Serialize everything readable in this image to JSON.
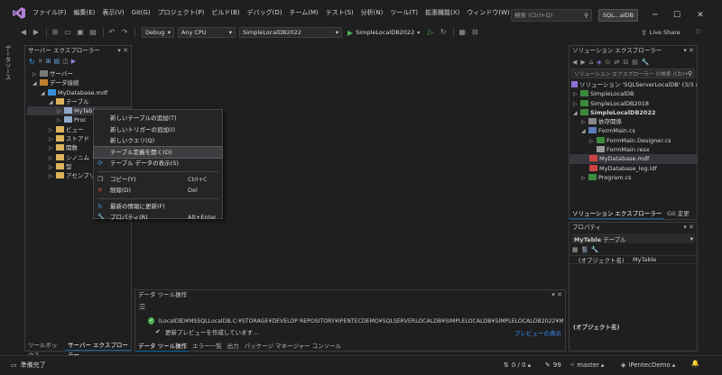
{
  "titlebar": {
    "menus": [
      "ファイル(F)",
      "編集(E)",
      "表示(V)",
      "Git(G)",
      "プロジェクト(P)",
      "ビルド(B)",
      "デバッグ(D)",
      "テスト(S)",
      "分析(N)",
      "ツール(T)",
      "拡張機能(X)",
      "ウィンドウ(W)",
      "ヘルプ(H)"
    ],
    "menu_extra": "チーム(M)",
    "search_placeholder": "検索 (Ctrl+Q)",
    "solution_badge": "SQL...alDB"
  },
  "toolbar": {
    "config": "Debug",
    "platform": "Any CPU",
    "startup_project": "SimpleLocalDB2022",
    "run_label": "SimpleLocalDB2022",
    "live_share": "Live Share"
  },
  "side_tab": "データソース",
  "server_explorer": {
    "title": "サーバー エクスプローラー",
    "items": [
      {
        "label": "サーバー",
        "indent": 0
      },
      {
        "label": "データ接続",
        "indent": 0
      },
      {
        "label": "MyDatabase.mdf",
        "indent": 1
      },
      {
        "label": "テーブル",
        "indent": 2
      },
      {
        "label": "MyTable",
        "indent": 3
      },
      {
        "label": "Proc",
        "indent": 3
      },
      {
        "label": "ビュー",
        "indent": 2
      },
      {
        "label": "ストアド",
        "indent": 2
      },
      {
        "label": "関数",
        "indent": 2
      },
      {
        "label": "シノニム",
        "indent": 2
      },
      {
        "label": "型",
        "indent": 2
      },
      {
        "label": "アセンブリ",
        "indent": 2
      }
    ],
    "tabs": [
      "ツールボックス",
      "サーバー エクスプローラー"
    ]
  },
  "context_menu": {
    "items": [
      {
        "label": "新しいテーブルの追加(T)",
        "shortcut": "",
        "icon": ""
      },
      {
        "label": "新しいトリガーの追加(I)",
        "shortcut": "",
        "icon": ""
      },
      {
        "label": "新しいクエリ(Q)",
        "shortcut": "",
        "icon": ""
      },
      {
        "label": "テーブル定義を開く(O)",
        "shortcut": "",
        "icon": "",
        "selected": true
      },
      {
        "label": "テーブル データの表示(S)",
        "shortcut": "",
        "icon": "⟳"
      },
      {
        "sep": true
      },
      {
        "label": "コピー(Y)",
        "shortcut": "Ctrl+C",
        "icon": "❐"
      },
      {
        "label": "削除(D)",
        "shortcut": "Del",
        "icon": "✕"
      },
      {
        "sep": true
      },
      {
        "label": "最新の情報に更新(F)",
        "shortcut": "",
        "icon": "↻"
      },
      {
        "label": "プロパティ(R)",
        "shortcut": "Alt+Enter",
        "icon": "🔧"
      }
    ]
  },
  "solution_explorer": {
    "title": "ソリューション エクスプローラー",
    "search_placeholder": "ソリューション エクスプローラー の検索 (Ctrl+;)",
    "items": [
      {
        "label": "ソリューション 'SQLServerLocalDB' (3/3 のプロジ",
        "indent": 0,
        "bold": false
      },
      {
        "label": "SimpleLocalDB",
        "indent": 1,
        "bold": false
      },
      {
        "label": "SimpleLocalDB2018",
        "indent": 1,
        "bold": false
      },
      {
        "label": "SimpleLocalDB2022",
        "indent": 1,
        "bold": true
      },
      {
        "label": "依存関係",
        "indent": 2,
        "bold": false
      },
      {
        "label": "FormMain.cs",
        "indent": 2,
        "bold": false
      },
      {
        "label": "FormMain.Designer.cs",
        "indent": 3,
        "bold": false
      },
      {
        "label": "FormMain.resx",
        "indent": 3,
        "bold": false
      },
      {
        "label": "MyDatabase.mdf",
        "indent": 2,
        "bold": false,
        "selected": true
      },
      {
        "label": "MyDatabase_log.ldf",
        "indent": 2,
        "bold": false
      },
      {
        "label": "Program.cs",
        "indent": 2,
        "bold": false
      }
    ],
    "tabs": [
      "ソリューション エクスプローラー",
      "Git 変更"
    ]
  },
  "properties": {
    "title": "プロパティ",
    "object": "MyTable",
    "object_type": "テーブル",
    "row_name": "(オブジェクト名)",
    "row_value": "MyTable",
    "desc_title": "(オブジェクト名)"
  },
  "data_tools": {
    "title": "データ ツール操作",
    "message": "(LocalDB)¥MSSQLLocalDB.C:¥STORAGE¥DEVELOP REPOSITORY¥IPENTECDEMO¥SQLSERVERLOCALDB¥SIMPLELOCALDB¥SIMPLELOCALDB2022¥MYDATABASE....",
    "progress": "更新プレビューを作成しています...",
    "preview_link": "プレビューの表示",
    "tabs": [
      "データ ツール操作",
      "エラー一覧",
      "出力",
      "パッケージ マネージャー コンソール"
    ]
  },
  "statusbar": {
    "ready": "準備完了",
    "updown": "0 / 0",
    "pencil": "99",
    "branch": "master",
    "repo": "iPentecDemo"
  },
  "colors": {
    "accent": "#0e639c",
    "link": "#3794ff",
    "success": "#4caf50",
    "vs_purple": "#8f6fd6"
  }
}
